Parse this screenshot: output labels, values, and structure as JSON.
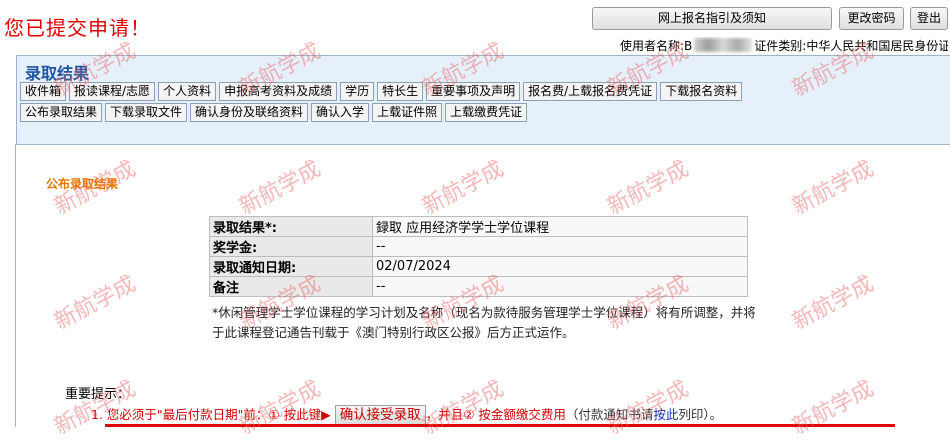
{
  "header": {
    "status_message": "您已提交申请！",
    "guide_button": "网上报名指引及须知",
    "change_password_button": "更改密码",
    "logout_button": "登出",
    "user_label": "使用者名称:",
    "user_value_prefix": "B",
    "id_type_label": "证件类别:",
    "id_type_value": "中华人民共和国居民身份证"
  },
  "panel": {
    "title": "录取结果",
    "tabs_row1": [
      "收件箱",
      "报读课程/志愿",
      "个人资料",
      "申报高考资料及成绩",
      "学历",
      "特长生",
      "重要事项及声明",
      "报名费/上载报名费凭证",
      "下载报名资料"
    ],
    "tabs_row2": [
      "公布录取结果",
      "下载录取文件",
      "确认身份及联络资料",
      "确认入学",
      "上载证件照",
      "上载缴费凭证"
    ]
  },
  "content": {
    "section_title": "公布录取结果",
    "result_table": [
      {
        "label": "录取结果*:",
        "value": "録取 应用经济学学士学位课程"
      },
      {
        "label": "奖学金:",
        "value": "--"
      },
      {
        "label": "录取通知日期:",
        "value": "02/07/2024"
      },
      {
        "label": "备注",
        "value": "--"
      }
    ],
    "note": "*休闲管理学士学位课程的学习计划及名称（现名为款待服务管理学士学位课程）将有所调整，并将于此课程登记通告刊载于《澳门特别行政区公报》后方正式运作。",
    "important_title": "重要提示：",
    "reminder": {
      "part1": "1. 您必须于\"最后付款日期\"前：① 按此键▶",
      "button": "确认接受录取",
      "part2": "，并且② 按金额缴交费用",
      "part3": "（付款通知书请",
      "link": "按此",
      "part4": "列印）。"
    }
  },
  "watermark": {
    "text": "新航学成",
    "color": "#e85f5f"
  }
}
